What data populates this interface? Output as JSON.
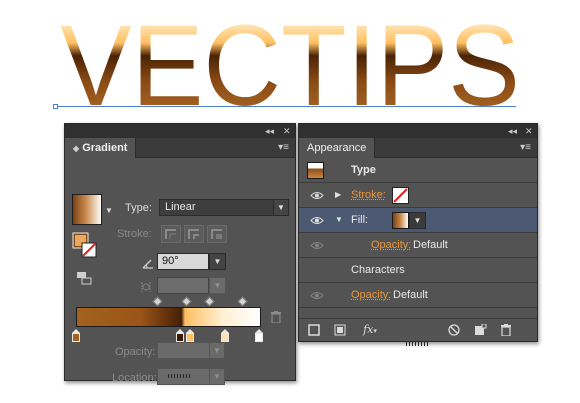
{
  "artwork": {
    "text": "VECTIPS",
    "gradient_colors": [
      "#a3621f",
      "#4a2306",
      "#ffbf62",
      "#fffaf0"
    ]
  },
  "gradient_panel": {
    "tab_label": "Gradient",
    "collapse_glyph": "◂◂",
    "close_glyph": "✕",
    "menu_glyph": "▾≡",
    "type_label": "Type:",
    "type_value": "Linear",
    "stroke_label": "Stroke:",
    "angle_value": "90°",
    "opacity_label": "Opacity:",
    "location_label": "Location:",
    "stop_colors": [
      "#a3621f",
      "#3a1a04",
      "#ffbf62",
      "#ffe2b4",
      "#ffffff"
    ],
    "icons": [
      "gradient-thumbnail-icon",
      "fill-stroke-icon",
      "reverse-gradient-icon",
      "angle-icon",
      "aspect-ratio-icon",
      "trash-icon"
    ]
  },
  "appearance_panel": {
    "tab_label": "Appearance",
    "collapse_glyph": "◂◂",
    "close_glyph": "✕",
    "menu_glyph": "▾≡",
    "header_label": "Type",
    "rows": {
      "stroke_label": "Stroke:",
      "fill_label": "Fill:",
      "fill_opacity_label": "Opacity:",
      "fill_opacity_value": "Default",
      "characters_label": "Characters",
      "opacity_label": "Opacity:",
      "opacity_value": "Default"
    },
    "fx_label": "fx",
    "accent_color": "#e8973a",
    "selected_row_color": "#4b5a72"
  }
}
